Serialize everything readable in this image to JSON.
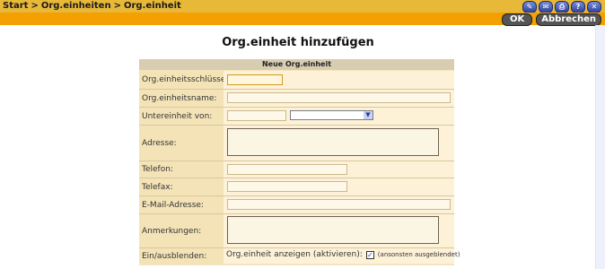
{
  "breadcrumb": [
    "Start",
    "Org.einheiten",
    "Org.einheit"
  ],
  "breadcrumb_sep": ">",
  "toolbar_icons": [
    "pen-icon",
    "mail-icon",
    "print-icon",
    "help-icon",
    "close-icon"
  ],
  "buttons": {
    "ok": "OK",
    "cancel": "Abbrechen"
  },
  "page_title": "Org.einheit hinzufügen",
  "form": {
    "header": "Neue Org.einheit",
    "key_label": "Org.einheitsschlüssel:",
    "name_label": "Org.einheitsname:",
    "parent_label": "Untereinheit von:",
    "address_label": "Adresse:",
    "phone_label": "Telefon:",
    "fax_label": "Telefax:",
    "email_label": "E-Mail-Adresse:",
    "notes_label": "Anmerkungen:",
    "show_label": "Ein/ausblenden:",
    "show_text": "Org.einheit anzeigen (aktivieren):",
    "show_checked": true,
    "show_hint": "(ansonsten ausgeblendet)"
  },
  "colors": {
    "topbar": "#e8b838",
    "buttonbar": "#f3a000",
    "form_bg": "#f3e4bd"
  }
}
